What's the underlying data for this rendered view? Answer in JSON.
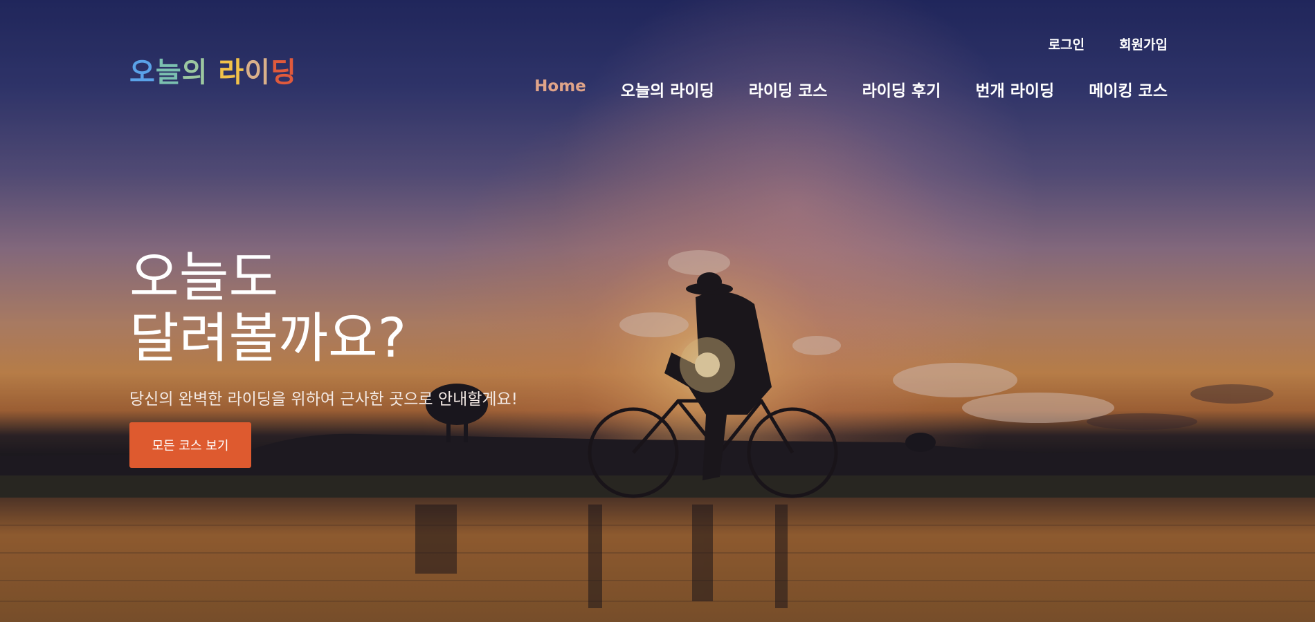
{
  "logo": {
    "chars": [
      {
        "ch": "오",
        "color": "#5aa2e8"
      },
      {
        "ch": "늘",
        "color": "#7bc0b0"
      },
      {
        "ch": "의",
        "color": "#9cc7a0"
      },
      {
        "ch": " ",
        "color": "#ffffff"
      },
      {
        "ch": "라",
        "color": "#f2c24a"
      },
      {
        "ch": "이",
        "color": "#d9b08a"
      },
      {
        "ch": "딩",
        "color": "#e05a3c"
      }
    ]
  },
  "top_links": {
    "login": "로그인",
    "signup": "회원가입"
  },
  "nav": {
    "home": "Home",
    "today_riding": "오늘의 라이딩",
    "riding_course": "라이딩 코스",
    "riding_review": "라이딩 후기",
    "flash_riding": "번개 라이딩",
    "making_course": "메이킹 코스",
    "active_color": "#e0a489"
  },
  "hero": {
    "headline_line1": "오늘도",
    "headline_line2": "달려볼까요?",
    "subtitle": "당신의 완벽한 라이딩을 위하여 근사한 곳으로 안내할게요!",
    "cta_label": "모든 코스 보기",
    "cta_color": "#de5a2f"
  },
  "background": {
    "image_icon": "sunset-cyclist-photo"
  }
}
